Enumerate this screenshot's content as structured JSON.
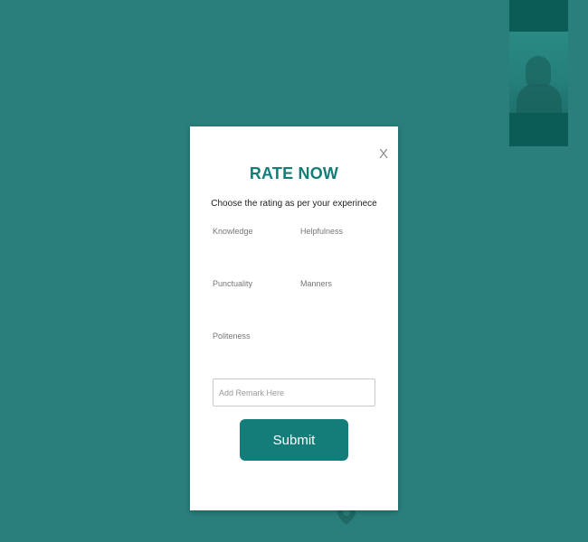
{
  "colors": {
    "backdrop": "#2a7f7c",
    "accent": "#137e79",
    "tile": "#0b5b57",
    "modal_bg": "#ffffff"
  },
  "video_tile": {
    "label": "",
    "icon": "participant-video-thumbnail"
  },
  "modal": {
    "close_label": "X",
    "title": "RATE NOW",
    "subtitle": "Choose the rating as per your experinece",
    "criteria": [
      {
        "label": "Knowledge"
      },
      {
        "label": "Helpfulness"
      },
      {
        "label": "Punctuality"
      },
      {
        "label": "Manners"
      },
      {
        "label": "Politeness"
      }
    ],
    "remark_placeholder": "Add Remark Here",
    "remark_value": "",
    "submit_label": "Submit"
  },
  "bottom_marker": {
    "icon": "location-pin-icon"
  }
}
